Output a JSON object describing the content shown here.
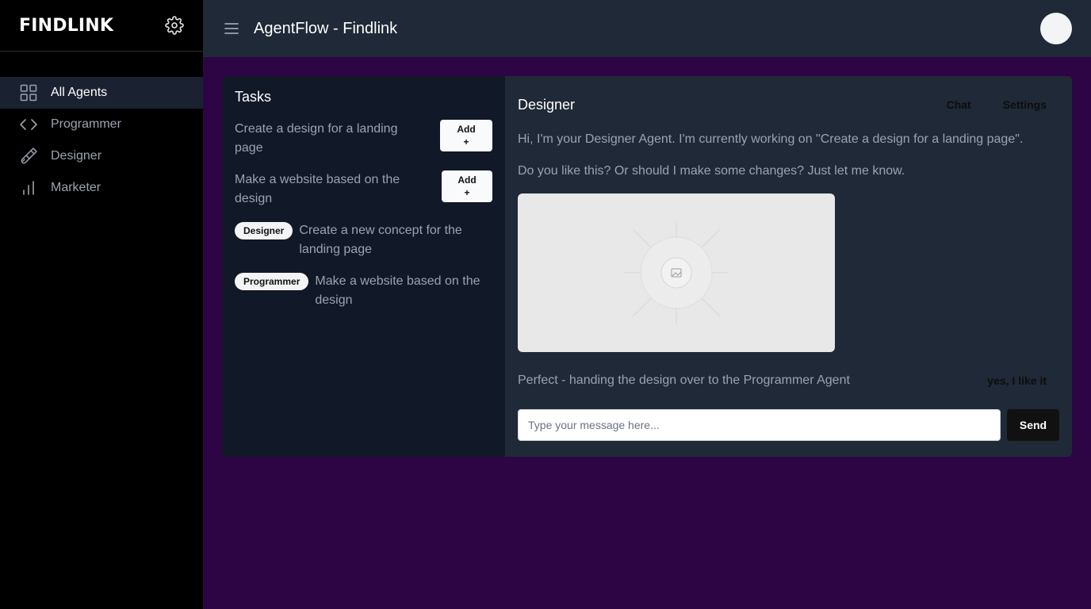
{
  "sidebar": {
    "brand": "FINDLINK",
    "items": [
      {
        "label": "All Agents",
        "icon": "grid-icon",
        "active": true
      },
      {
        "label": "Programmer",
        "icon": "code-icon"
      },
      {
        "label": "Designer",
        "icon": "paintbrush-icon"
      },
      {
        "label": "Marketer",
        "icon": "bar-chart-icon"
      }
    ]
  },
  "header": {
    "title": "AgentFlow - Findlink"
  },
  "tasks": {
    "title": "Tasks",
    "unassigned": [
      {
        "text": "Create a design for a landing page",
        "button": "Add",
        "button_icon": "+"
      },
      {
        "text": "Make a website based on the design",
        "button": "Add",
        "button_icon": "+"
      }
    ],
    "assigned": [
      {
        "agent": "Designer",
        "text": "Create a new concept for the landing page"
      },
      {
        "agent": "Programmer",
        "text": "Make a website based on the design"
      }
    ]
  },
  "chat": {
    "agent_name": "Designer",
    "tabs": [
      "Chat",
      "Settings"
    ],
    "messages": [
      "Hi, I'm your Designer Agent. I'm currently working on \"Create a design for a landing page\".",
      "Do you like this? Or should I make some changes? Just let me know."
    ],
    "agent_reply": "Perfect - handing the design over to the Programmer Agent",
    "user_reply": "yes, I like it",
    "input_placeholder": "Type your message here...",
    "input_value": "",
    "send_label": "Send"
  },
  "colors": {
    "sidebar_bg": "#000000",
    "topbar_bg": "#1f2937",
    "page_bg": "#2d0545",
    "tasks_bg": "#111827",
    "chat_bg": "#1f2937",
    "active_nav_bg": "#1a2231"
  }
}
